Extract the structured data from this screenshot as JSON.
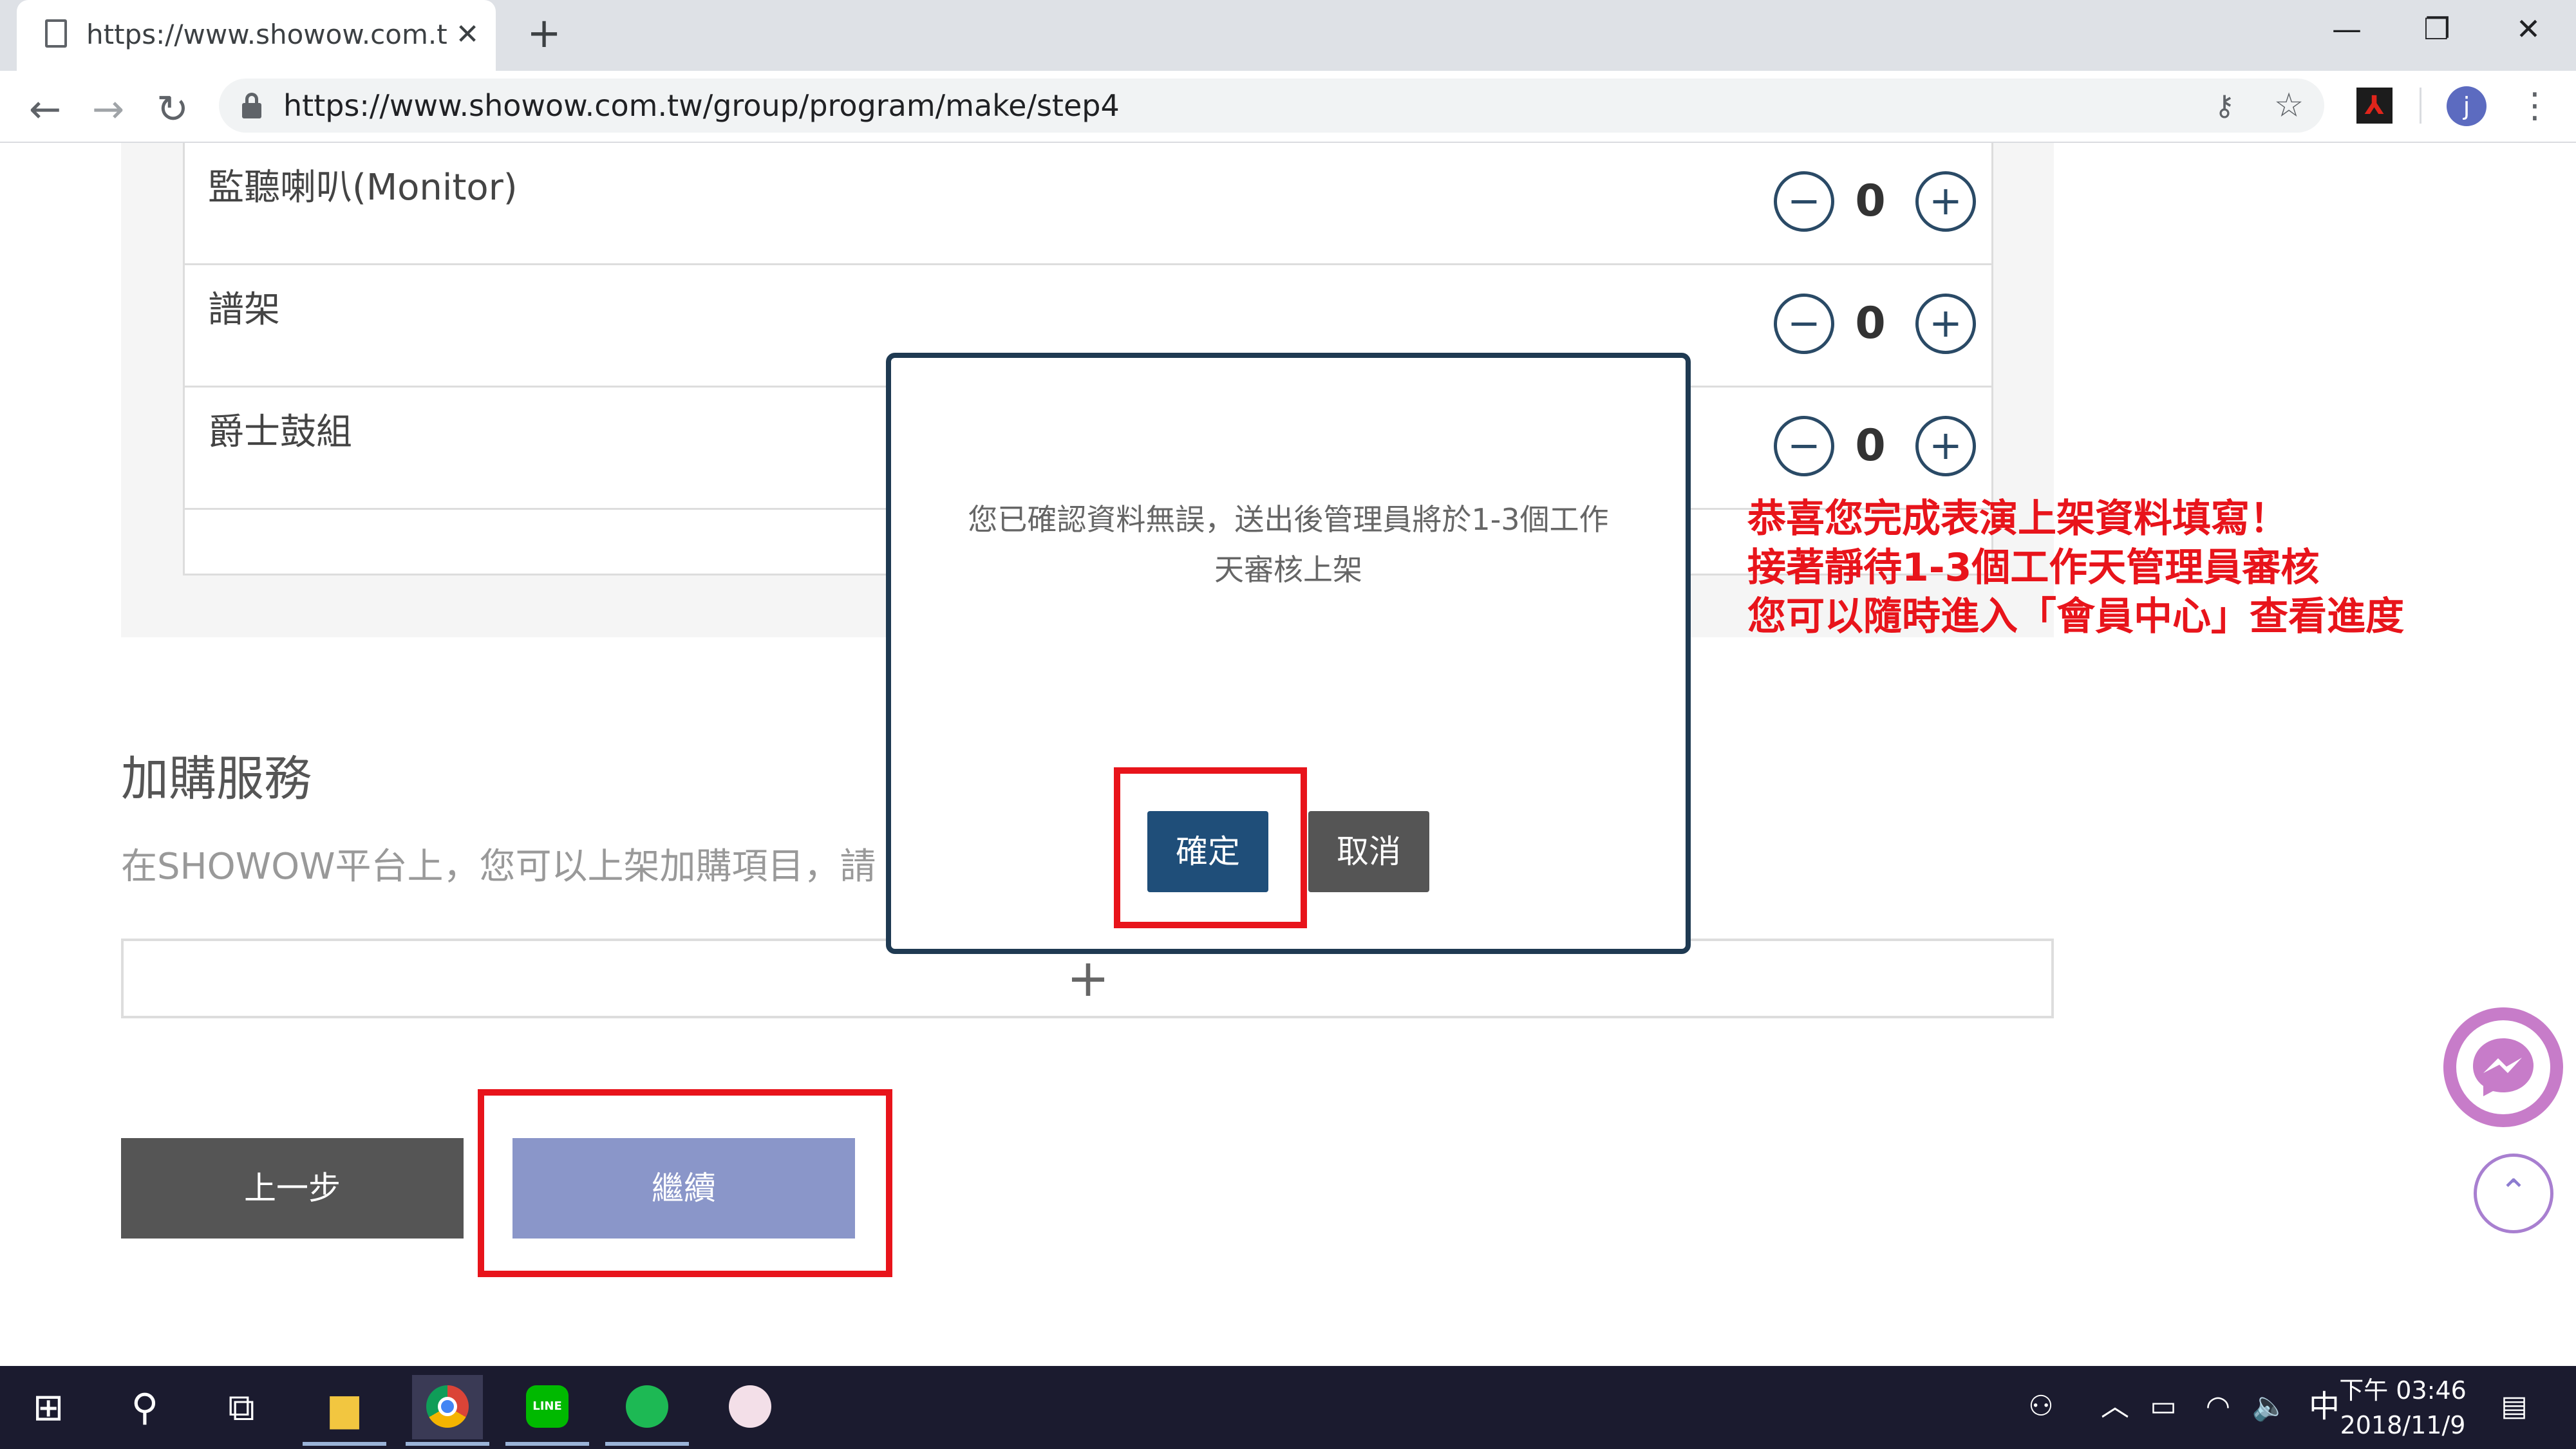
{
  "browser": {
    "tab_title": "https://www.showow.com.tw/g",
    "tab_close": "✕",
    "new_tab": "+",
    "window_controls": {
      "minimize": "—",
      "restore": "❐",
      "close": "✕"
    },
    "nav": {
      "back": "←",
      "forward": "→",
      "reload": "↻"
    },
    "url": "https://www.showow.com.tw/group/program/make/step4",
    "key_icon": "⚷",
    "star_icon": "☆",
    "pdf_icon": "⅄",
    "profile_initial": "j",
    "menu_icon": "⋮"
  },
  "equipment": {
    "rows": [
      {
        "label": "監聽喇叭(Monitor)",
        "qty": "0"
      },
      {
        "label": "譜架",
        "qty": "0"
      },
      {
        "label": "爵士鼓組",
        "qty": "0"
      }
    ],
    "minus": "−",
    "plus": "+"
  },
  "addon": {
    "heading": "加購服務",
    "description": "在SHOWOW平台上，您可以上架加購項目，請",
    "add_icon": "+"
  },
  "buttons": {
    "prev": "上一步",
    "continue": "繼續"
  },
  "modal": {
    "message_line1": "您已確認資料無誤，送出後管理員將於1-3個工作",
    "message_line2": "天審核上架",
    "confirm": "確定",
    "cancel": "取消"
  },
  "annotation": {
    "line1": "恭喜您完成表演上架資料填寫！",
    "line2": "接著靜待1-3個工作天管理員審核",
    "line3": "您可以隨時進入「會員中心」查看進度"
  },
  "scrolltop_icon": "⌃",
  "taskbar": {
    "start_icon": "⊞",
    "search_icon": "⚲",
    "taskview_icon": "⧉",
    "explorer_icon": "▆",
    "line_label": "LINE",
    "tray": {
      "people": "⚇",
      "chevron": "︿",
      "battery": "▭",
      "wifi": "◠",
      "volume": "🔈",
      "ime": "中",
      "notification": "▤"
    },
    "time": "下午 03:46",
    "date": "2018/11/9"
  },
  "colors": {
    "header_navy": "#1f3a52",
    "confirm_blue": "#1f4e79",
    "continue_lavender": "#8a96c9",
    "annotation_red": "#e8141b",
    "messenger_pink": "#c77cc9"
  }
}
